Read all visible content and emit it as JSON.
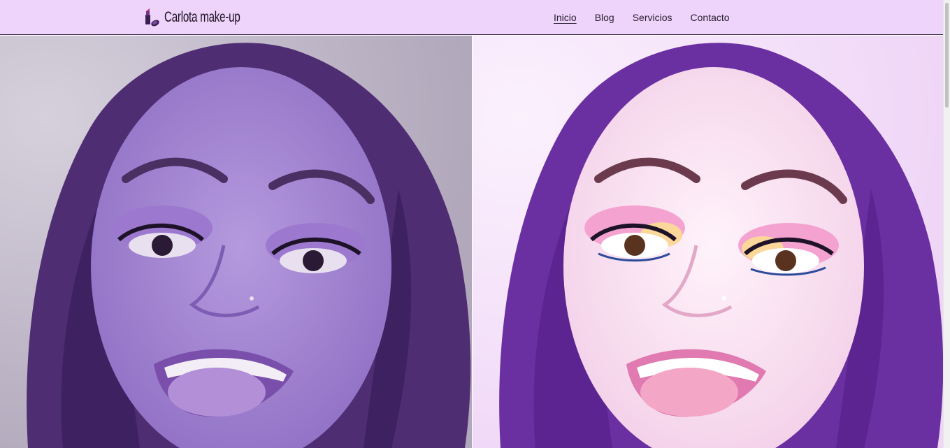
{
  "brand": {
    "name": "Carlota make-up",
    "icon": "lipstick-icon"
  },
  "nav": {
    "items": [
      {
        "label": "Inicio",
        "active": true
      },
      {
        "label": "Blog",
        "active": false
      },
      {
        "label": "Servicios",
        "active": false
      },
      {
        "label": "Contacto",
        "active": false
      }
    ]
  },
  "hero": {
    "left_image": "portrait-before-makeup",
    "right_image": "portrait-after-makeup"
  },
  "colors": {
    "navbar_bg": "#eed3fb",
    "hair": "#5c2f86",
    "accent_pink": "#f4a3d0"
  }
}
